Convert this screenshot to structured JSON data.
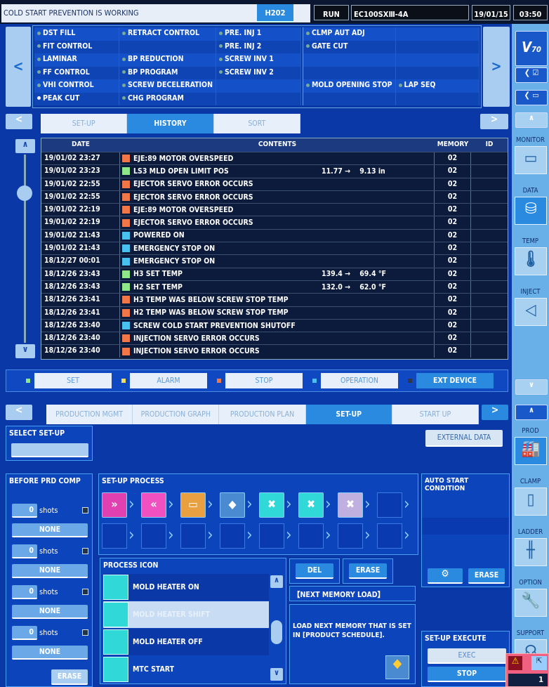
{
  "topbar": {
    "status": "COLD START PREVENTION IS WORKING",
    "tab": "H202",
    "mode": "RUN",
    "model": "EC100SXⅢ-4A",
    "date": "19/01/15",
    "time": "03:50"
  },
  "functions": {
    "col1": [
      "DST FILL",
      "FIT CONTROL",
      "LAMINAR",
      "FF CONTROL",
      "VHI CONTROL",
      "PEAK CUT"
    ],
    "col2": [
      "RETRACT CONTROL",
      "",
      "BP REDUCTION",
      "BP PROGRAM",
      "SCREW DECELERATION",
      "CHG PROGRAM"
    ],
    "col3": [
      "PRE. INJ 1",
      "PRE. INJ 2",
      "SCREW INV 1",
      "SCREW INV 2",
      "",
      ""
    ],
    "col4": [
      "CLMP AUT ADJ",
      "GATE CUT",
      "",
      "",
      "MOLD OPENING STOP",
      ""
    ],
    "col5": [
      "",
      "",
      "",
      "",
      "LAP SEQ",
      ""
    ],
    "active": "PEAK CUT"
  },
  "tabs1": [
    {
      "label": "SET-UP",
      "active": false
    },
    {
      "label": "HISTORY",
      "active": true
    },
    {
      "label": "SORT",
      "active": false
    }
  ],
  "history": {
    "headers": [
      "DATE",
      "CONTENTS",
      "MEMORY",
      "ID"
    ],
    "rows": [
      {
        "date": "19/01/02 23:27",
        "type": "stop",
        "text": "EJE:89 MOTOR OVERSPEED",
        "value": "",
        "memory": "02"
      },
      {
        "date": "19/01/02 23:23",
        "type": "set",
        "text": "LS3 MLD OPEN LIMIT POS",
        "value": "11.77 →    9.13 in",
        "memory": "02"
      },
      {
        "date": "19/01/02 22:55",
        "type": "stop",
        "text": "EJECTOR SERVO ERROR OCCURS",
        "value": "",
        "memory": "02"
      },
      {
        "date": "19/01/02 22:55",
        "type": "stop",
        "text": "EJECTOR SERVO ERROR OCCURS",
        "value": "",
        "memory": "02"
      },
      {
        "date": "19/01/02 22:19",
        "type": "stop",
        "text": "EJE:89 MOTOR OVERSPEED",
        "value": "",
        "memory": "02"
      },
      {
        "date": "19/01/02 22:19",
        "type": "stop",
        "text": "EJECTOR SERVO ERROR OCCURS",
        "value": "",
        "memory": "02"
      },
      {
        "date": "19/01/02 21:43",
        "type": "operation",
        "text": "POWERED ON",
        "value": "",
        "memory": "02"
      },
      {
        "date": "19/01/02 21:43",
        "type": "operation",
        "text": "EMERGENCY STOP ON",
        "value": "",
        "memory": "02"
      },
      {
        "date": "18/12/27 00:01",
        "type": "operation",
        "text": "EMERGENCY STOP ON",
        "value": "",
        "memory": "02"
      },
      {
        "date": "18/12/26 23:43",
        "type": "set",
        "text": "H3 SET TEMP",
        "value": "139.4 →    69.4 °F",
        "memory": "02"
      },
      {
        "date": "18/12/26 23:43",
        "type": "set",
        "text": "H2 SET TEMP",
        "value": "132.0 →    62.0 °F",
        "memory": "02"
      },
      {
        "date": "18/12/26 23:41",
        "type": "stop",
        "text": "H3 TEMP WAS BELOW SCREW STOP TEMP",
        "value": "",
        "memory": "02"
      },
      {
        "date": "18/12/26 23:41",
        "type": "stop",
        "text": "H2 TEMP WAS BELOW SCREW STOP TEMP",
        "value": "",
        "memory": "02"
      },
      {
        "date": "18/12/26 23:40",
        "type": "operation",
        "text": "SCREW COLD START PREVENTION SHUTOFF",
        "value": "",
        "memory": "02"
      },
      {
        "date": "18/12/26 23:40",
        "type": "stop",
        "text": "INJECTION SERVO ERROR OCCURS",
        "value": "",
        "memory": "02"
      },
      {
        "date": "18/12/26 23:40",
        "type": "stop",
        "text": "INJECTION SERVO ERROR OCCURS",
        "value": "",
        "memory": "02"
      }
    ]
  },
  "colors": {
    "set": "#8ee88a",
    "alarm": "#f0e060",
    "stop": "#f07848",
    "operation": "#48c0f0",
    "ext": "#303848"
  },
  "legend": [
    {
      "key": "set",
      "label": "SET"
    },
    {
      "key": "alarm",
      "label": "ALARM"
    },
    {
      "key": "stop",
      "label": "STOP"
    },
    {
      "key": "operation",
      "label": "OPERATION"
    },
    {
      "key": "ext",
      "label": "EXT DEVICE"
    }
  ],
  "tabs2": [
    {
      "label": "PRODUCTION MGMT",
      "active": false
    },
    {
      "label": "PRODUCTION GRAPH",
      "active": false
    },
    {
      "label": "PRODUCTION PLAN",
      "active": false
    },
    {
      "label": "SET-UP",
      "active": true
    },
    {
      "label": "START UP",
      "active": false
    }
  ],
  "select_setup": {
    "title": "SELECT SET-UP",
    "value": ""
  },
  "external_data": "EXTERNAL DATA",
  "before_prd": {
    "title": "BEFORE PRD COMP",
    "items": [
      {
        "shots": "0",
        "unit": "shots",
        "mode": "NONE"
      },
      {
        "shots": "0",
        "unit": "shots",
        "mode": "NONE"
      },
      {
        "shots": "0",
        "unit": "shots",
        "mode": "NONE"
      },
      {
        "shots": "0",
        "unit": "shots",
        "mode": "NONE"
      }
    ],
    "erase": "ERASE"
  },
  "setup_process": {
    "title": "SET-UP PROCESS",
    "icons": [
      "nozzle-forward",
      "nozzle-back",
      "mold-heater-shift",
      "next-memory-load",
      "mold-heater-off",
      "mtc-stop",
      "dryer-off",
      ""
    ]
  },
  "process_icon": {
    "title": "PROCESS ICON",
    "items": [
      "MOLD HEATER ON",
      "MOLD HEATER SHIFT",
      "MOLD HEATER OFF",
      "MTC START"
    ],
    "selected": "MOLD HEATER SHIFT"
  },
  "actions": {
    "del": "DEL",
    "erase": "ERASE"
  },
  "next_memory": {
    "title": "【NEXT MEMORY LOAD】",
    "desc": "LOAD NEXT MEMORY THAT IS SET IN [PRODUCT SCHEDULE]."
  },
  "auto_start": {
    "title": "AUTO START CONDITION",
    "erase": "ERASE"
  },
  "execute": {
    "title": "SET-UP EXECUTE",
    "exec": "EXEC",
    "stop": "STOP"
  },
  "sidebar": {
    "monitor": "MONITOR",
    "data": "DATA",
    "temp": "TEMP",
    "inject": "INJECT",
    "prod": "PROD",
    "clamp": "CLAMP",
    "ladder": "LADDER",
    "option": "OPTION",
    "support": "SUPPORT"
  },
  "alarm_popup": {
    "count": "1"
  }
}
